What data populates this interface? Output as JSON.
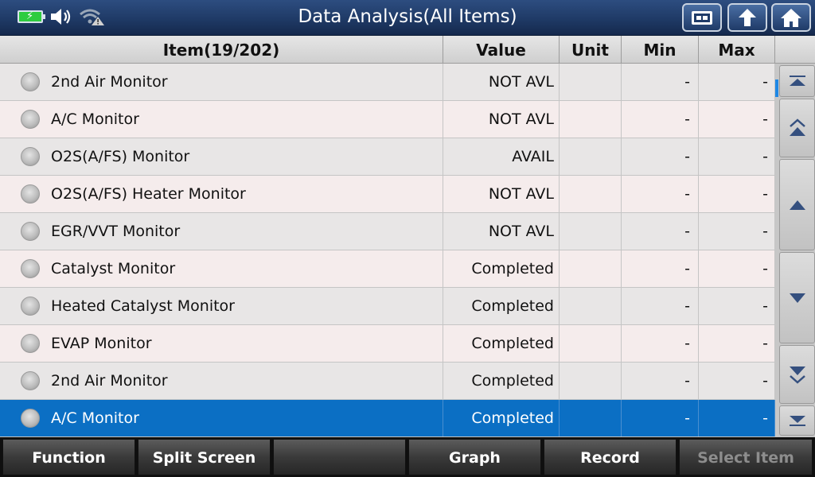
{
  "header": {
    "title": "Data Analysis(All Items)",
    "status_icons": [
      "battery-charging-icon",
      "speaker-icon",
      "wifi-warning-icon"
    ],
    "buttons": [
      "screenshot-icon",
      "back-icon",
      "home-icon"
    ]
  },
  "table": {
    "columns": {
      "item": "Item(19/202)",
      "value": "Value",
      "unit": "Unit",
      "min": "Min",
      "max": "Max"
    },
    "rows": [
      {
        "item": "2nd Air Monitor",
        "value": "NOT AVL",
        "unit": "",
        "min": "-",
        "max": "-"
      },
      {
        "item": "A/C Monitor",
        "value": "NOT AVL",
        "unit": "",
        "min": "-",
        "max": "-"
      },
      {
        "item": "O2S(A/FS) Monitor",
        "value": "AVAIL",
        "unit": "",
        "min": "-",
        "max": "-"
      },
      {
        "item": "O2S(A/FS) Heater Monitor",
        "value": "NOT AVL",
        "unit": "",
        "min": "-",
        "max": "-"
      },
      {
        "item": "EGR/VVT Monitor",
        "value": "NOT AVL",
        "unit": "",
        "min": "-",
        "max": "-"
      },
      {
        "item": "Catalyst Monitor",
        "value": "Completed",
        "unit": "",
        "min": "-",
        "max": "-"
      },
      {
        "item": "Heated Catalyst Monitor",
        "value": "Completed",
        "unit": "",
        "min": "-",
        "max": "-"
      },
      {
        "item": "EVAP Monitor",
        "value": "Completed",
        "unit": "",
        "min": "-",
        "max": "-"
      },
      {
        "item": "2nd Air Monitor",
        "value": "Completed",
        "unit": "",
        "min": "-",
        "max": "-"
      },
      {
        "item": "A/C Monitor",
        "value": "Completed",
        "unit": "",
        "min": "-",
        "max": "-"
      }
    ],
    "selected_row": 9,
    "selected_color": "#0b6fc4"
  },
  "scroll": {
    "buttons": [
      "scroll-top-icon",
      "page-up-icon",
      "up-icon",
      "down-icon",
      "page-down-icon",
      "scroll-bottom-icon"
    ]
  },
  "footer": {
    "buttons": [
      {
        "label": "Function",
        "enabled": true
      },
      {
        "label": "Split Screen",
        "enabled": true
      },
      {
        "label": "",
        "enabled": true
      },
      {
        "label": "Graph",
        "enabled": true
      },
      {
        "label": "Record",
        "enabled": true
      },
      {
        "label": "Select Item",
        "enabled": false
      }
    ]
  }
}
